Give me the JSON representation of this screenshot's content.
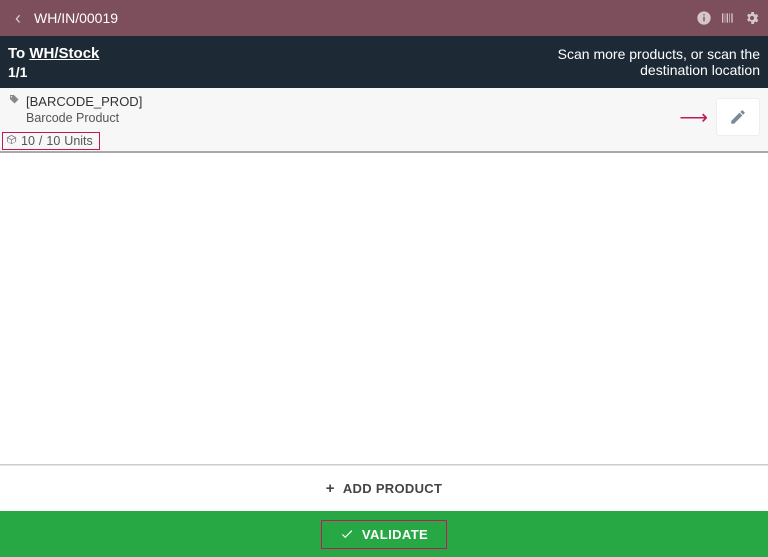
{
  "header": {
    "title": "WH/IN/00019"
  },
  "subheader": {
    "to_prefix": "To ",
    "destination": "WH/Stock",
    "count": "1/1",
    "hint": "Scan more products, or scan the destination location"
  },
  "line": {
    "reference": "[BARCODE_PROD]",
    "product_name": "Barcode Product",
    "qty_done": "10",
    "qty_sep": "/",
    "qty_demand": "10",
    "uom": "Units"
  },
  "actions": {
    "add_product": "ADD PRODUCT",
    "validate": "VALIDATE"
  }
}
